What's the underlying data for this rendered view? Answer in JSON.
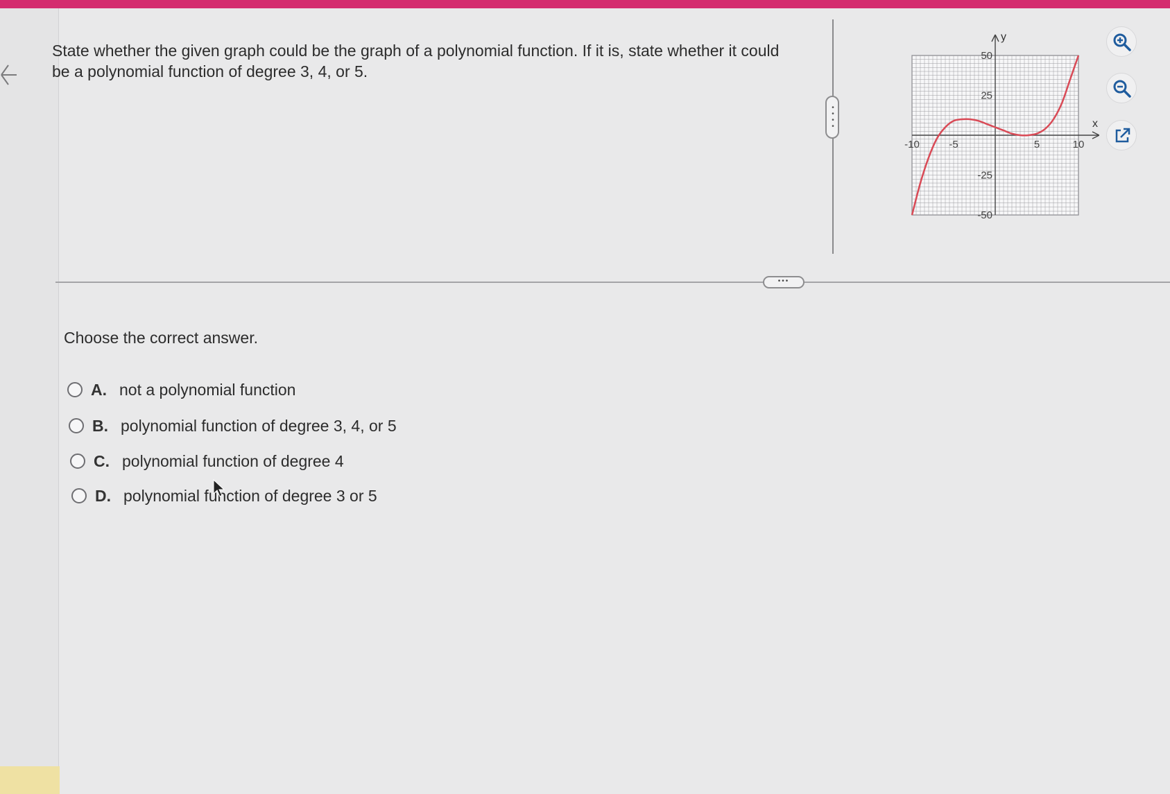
{
  "question": {
    "text": "State whether the given graph could be the graph of a polynomial function. If it is, state whether it could be a polynomial function of degree 3, 4, or 5."
  },
  "prompt": "Choose the correct answer.",
  "options": [
    {
      "letter": "A.",
      "text": "not a polynomial function"
    },
    {
      "letter": "B.",
      "text": "polynomial function of degree 3, 4, or 5"
    },
    {
      "letter": "C.",
      "text": "polynomial function of degree 4"
    },
    {
      "letter": "D.",
      "text": "polynomial function of degree 3 or 5"
    }
  ],
  "graph": {
    "x_axis_label": "x",
    "y_axis_label": "y",
    "x_ticks": [
      "-10",
      "-5",
      "5",
      "10"
    ],
    "y_ticks": [
      "50",
      "25",
      "-25",
      "-50"
    ],
    "curve_color": "#d94a56"
  },
  "chart_data": {
    "type": "line",
    "xlabel": "x",
    "ylabel": "y",
    "xlim": [
      -10,
      10
    ],
    "ylim": [
      -50,
      50
    ],
    "grid": true,
    "x": [
      -10,
      -9,
      -8,
      -7,
      -6,
      -5,
      -4,
      -3,
      -2,
      -1,
      0,
      1,
      2,
      3,
      4,
      5,
      6,
      7,
      8,
      9,
      10
    ],
    "series": [
      {
        "values": [
          -50,
          -30,
          -14,
          -2,
          5,
          9,
          10,
          10,
          9,
          7,
          5,
          3,
          1,
          0,
          0,
          1,
          4,
          10,
          20,
          35,
          50
        ]
      }
    ]
  },
  "icons": {
    "zoom_in": "zoom-in-icon",
    "zoom_out": "zoom-out-icon",
    "popout": "external-link-icon",
    "back": "arrow-left-icon"
  },
  "colors": {
    "top_bar": "#d42d6f",
    "background": "#e9e9ea"
  }
}
